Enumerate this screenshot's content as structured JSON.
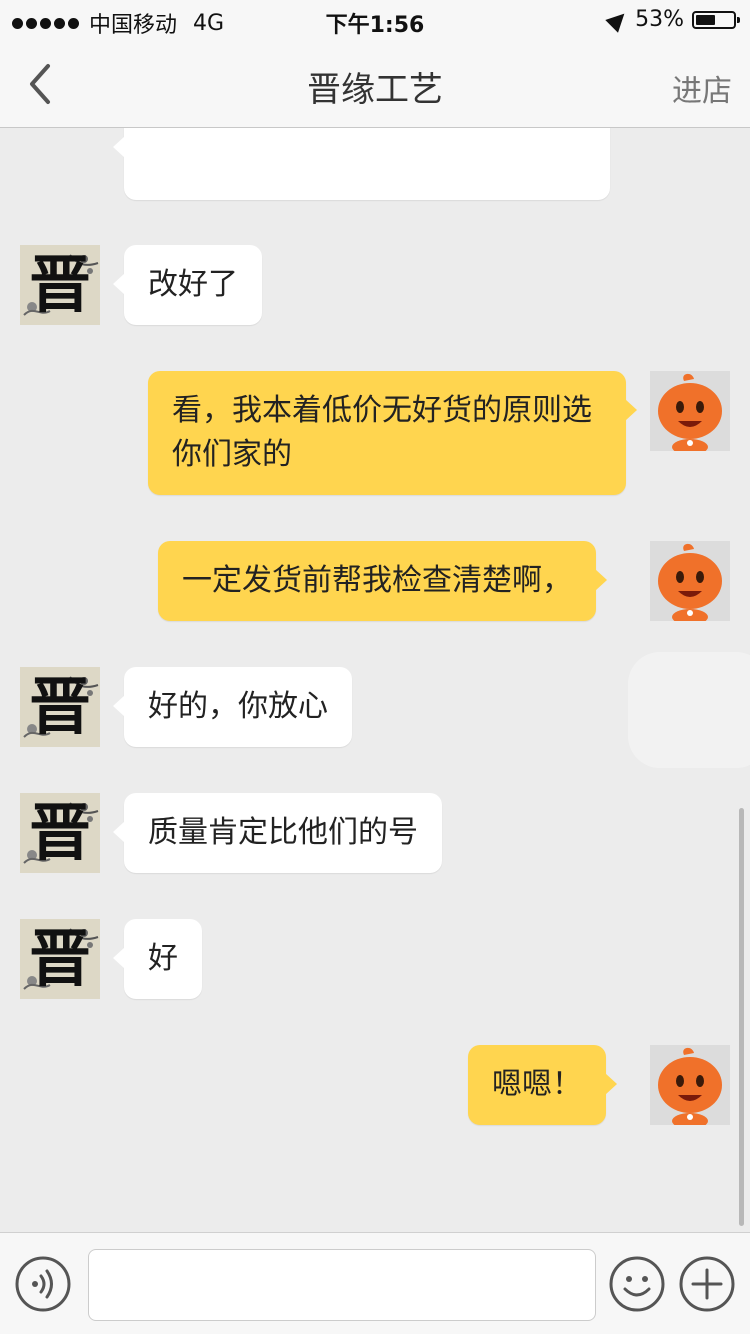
{
  "status_bar": {
    "carrier": "中国移动",
    "network": "4G",
    "time": "下午1:56",
    "battery_text": "53%",
    "battery_level": 0.53
  },
  "nav": {
    "back_icon": "chevron-left-icon",
    "title": "晋缘工艺",
    "right_action": "进店"
  },
  "shop_avatar": {
    "glyph": "晋"
  },
  "messages": [
    {
      "from": "shop",
      "text": ""
    },
    {
      "from": "shop",
      "text": "改好了"
    },
    {
      "from": "user",
      "text": "看，我本着低价无好货的原则选你们家的"
    },
    {
      "from": "user",
      "text": "一定发货前帮我检查清楚啊，"
    },
    {
      "from": "shop",
      "text": "好的，你放心"
    },
    {
      "from": "shop",
      "text": "质量肯定比他们的号"
    },
    {
      "from": "shop",
      "text": "好"
    },
    {
      "from": "user",
      "text": "嗯嗯！"
    }
  ],
  "input_bar": {
    "voice_icon": "voice-icon",
    "text_value": "",
    "emoji_icon": "smiley-icon",
    "plus_icon": "plus-icon"
  },
  "colors": {
    "chat_background": "#ececec",
    "incoming_bubble": "#ffffff",
    "outgoing_bubble": "#ffd54f",
    "user_avatar_orange": "#f0712a"
  }
}
